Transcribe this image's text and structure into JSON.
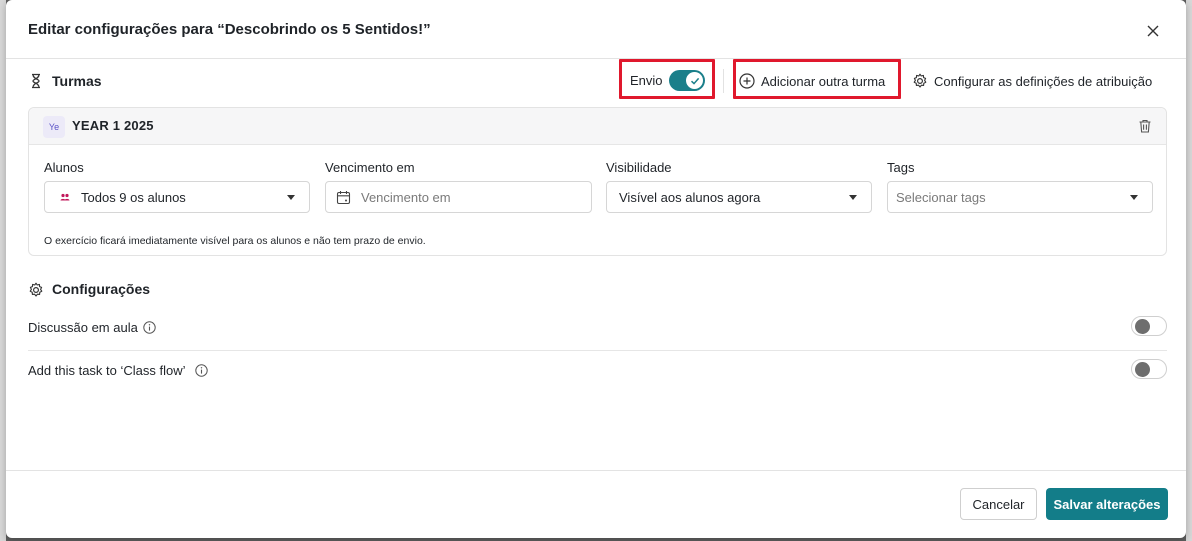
{
  "dialog": {
    "title": "Editar configurações para “Descobrindo os 5 Sentidos!”"
  },
  "turmas": {
    "label": "Turmas",
    "envio_label": "Envio",
    "envio_on": true,
    "add_class_label": "Adicionar outra turma",
    "config_attr_label": "Configurar as definições de atribuição"
  },
  "class_card": {
    "avatar_text": "Ye",
    "name": "YEAR 1 2025",
    "fields": {
      "alunos": {
        "label": "Alunos",
        "value": "Todos 9 os alunos"
      },
      "vencimento": {
        "label": "Vencimento em",
        "placeholder": "Vencimento em"
      },
      "visibilidade": {
        "label": "Visibilidade",
        "value": "Visível aos alunos agora"
      },
      "tags": {
        "label": "Tags",
        "placeholder": "Selecionar tags"
      }
    },
    "info": "O exercício ficará imediatamente visível para os alunos e não tem prazo de envio."
  },
  "configuracoes": {
    "title": "Configurações",
    "settings": [
      {
        "label": "Discussão em aula",
        "enabled": false
      },
      {
        "label": "Add this task to ‘Class flow’",
        "enabled": false
      }
    ]
  },
  "footer": {
    "cancel_label": "Cancelar",
    "save_label": "Salvar alterações"
  },
  "colors": {
    "accent": "#137d89",
    "highlight": "#e0182d"
  }
}
